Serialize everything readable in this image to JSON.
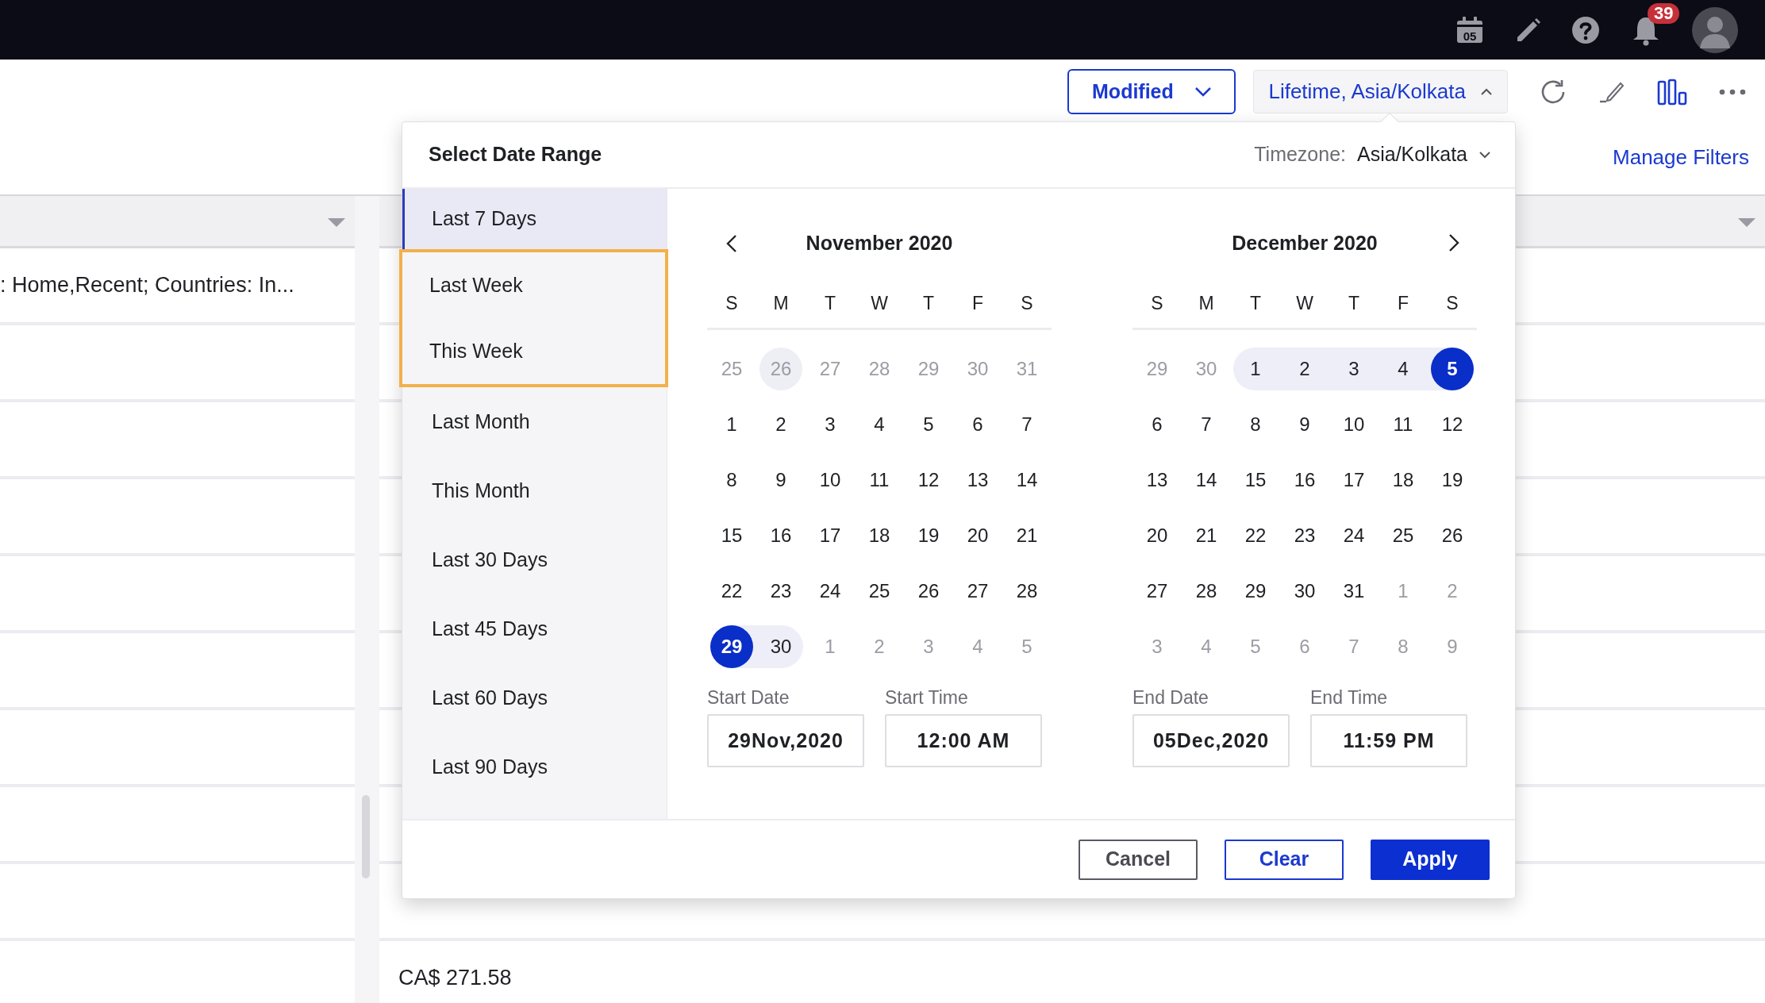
{
  "top_bar": {
    "calendar_day": "05",
    "notification_count": "39"
  },
  "toolbar": {
    "sort_button": "Modified",
    "date_button": "Lifetime, Asia/Kolkata",
    "date_expanded": true,
    "manage_filters": "Manage Filters"
  },
  "background_table": {
    "filter_cell": ": Home,Recent; Countries: In...",
    "amount_cell": "CA$ 271.58"
  },
  "date_picker": {
    "title": "Select Date Range",
    "timezone_label": "Timezone:",
    "timezone": "Asia/Kolkata",
    "presets": [
      {
        "label": "Last 7 Days",
        "selected": true,
        "highlighted": false
      },
      {
        "label": "Last Week",
        "selected": false,
        "highlighted": true
      },
      {
        "label": "This Week",
        "selected": false,
        "highlighted": true
      },
      {
        "label": "Last Month",
        "selected": false,
        "highlighted": false
      },
      {
        "label": "This Month",
        "selected": false,
        "highlighted": false
      },
      {
        "label": "Last 30 Days",
        "selected": false,
        "highlighted": false
      },
      {
        "label": "Last 45 Days",
        "selected": false,
        "highlighted": false
      },
      {
        "label": "Last 60 Days",
        "selected": false,
        "highlighted": false
      },
      {
        "label": "Last 90 Days",
        "selected": false,
        "highlighted": false
      }
    ],
    "months": [
      {
        "title": "November 2020",
        "prev_arrow": true,
        "next_arrow": false,
        "weekdays": [
          "S",
          "M",
          "T",
          "W",
          "T",
          "F",
          "S"
        ],
        "days": [
          {
            "day": "25",
            "kind": "outside"
          },
          {
            "day": "26",
            "kind": "today"
          },
          {
            "day": "27",
            "kind": "outside"
          },
          {
            "day": "28",
            "kind": "outside"
          },
          {
            "day": "29",
            "kind": "outside"
          },
          {
            "day": "30",
            "kind": "outside"
          },
          {
            "day": "31",
            "kind": "outside"
          },
          {
            "day": "1",
            "kind": "normal"
          },
          {
            "day": "2",
            "kind": "normal"
          },
          {
            "day": "3",
            "kind": "normal"
          },
          {
            "day": "4",
            "kind": "normal"
          },
          {
            "day": "5",
            "kind": "normal"
          },
          {
            "day": "6",
            "kind": "normal"
          },
          {
            "day": "7",
            "kind": "normal"
          },
          {
            "day": "8",
            "kind": "normal"
          },
          {
            "day": "9",
            "kind": "normal"
          },
          {
            "day": "10",
            "kind": "normal"
          },
          {
            "day": "11",
            "kind": "normal"
          },
          {
            "day": "12",
            "kind": "normal"
          },
          {
            "day": "13",
            "kind": "normal"
          },
          {
            "day": "14",
            "kind": "normal"
          },
          {
            "day": "15",
            "kind": "normal"
          },
          {
            "day": "16",
            "kind": "normal"
          },
          {
            "day": "17",
            "kind": "normal"
          },
          {
            "day": "18",
            "kind": "normal"
          },
          {
            "day": "19",
            "kind": "normal"
          },
          {
            "day": "20",
            "kind": "normal"
          },
          {
            "day": "21",
            "kind": "normal"
          },
          {
            "day": "22",
            "kind": "normal"
          },
          {
            "day": "23",
            "kind": "normal"
          },
          {
            "day": "24",
            "kind": "normal"
          },
          {
            "day": "25",
            "kind": "normal"
          },
          {
            "day": "26",
            "kind": "normal"
          },
          {
            "day": "27",
            "kind": "normal"
          },
          {
            "day": "28",
            "kind": "normal"
          },
          {
            "day": "29",
            "kind": "start"
          },
          {
            "day": "30",
            "kind": "range"
          },
          {
            "day": "1",
            "kind": "outside"
          },
          {
            "day": "2",
            "kind": "outside"
          },
          {
            "day": "3",
            "kind": "outside"
          },
          {
            "day": "4",
            "kind": "outside"
          },
          {
            "day": "5",
            "kind": "outside"
          }
        ]
      },
      {
        "title": "December 2020",
        "prev_arrow": false,
        "next_arrow": true,
        "weekdays": [
          "S",
          "M",
          "T",
          "W",
          "T",
          "F",
          "S"
        ],
        "days": [
          {
            "day": "29",
            "kind": "outside"
          },
          {
            "day": "30",
            "kind": "outside"
          },
          {
            "day": "1",
            "kind": "range"
          },
          {
            "day": "2",
            "kind": "range"
          },
          {
            "day": "3",
            "kind": "range"
          },
          {
            "day": "4",
            "kind": "range"
          },
          {
            "day": "5",
            "kind": "end"
          },
          {
            "day": "6",
            "kind": "normal"
          },
          {
            "day": "7",
            "kind": "normal"
          },
          {
            "day": "8",
            "kind": "normal"
          },
          {
            "day": "9",
            "kind": "normal"
          },
          {
            "day": "10",
            "kind": "normal"
          },
          {
            "day": "11",
            "kind": "normal"
          },
          {
            "day": "12",
            "kind": "normal"
          },
          {
            "day": "13",
            "kind": "normal"
          },
          {
            "day": "14",
            "kind": "normal"
          },
          {
            "day": "15",
            "kind": "normal"
          },
          {
            "day": "16",
            "kind": "normal"
          },
          {
            "day": "17",
            "kind": "normal"
          },
          {
            "day": "18",
            "kind": "normal"
          },
          {
            "day": "19",
            "kind": "normal"
          },
          {
            "day": "20",
            "kind": "normal"
          },
          {
            "day": "21",
            "kind": "normal"
          },
          {
            "day": "22",
            "kind": "normal"
          },
          {
            "day": "23",
            "kind": "normal"
          },
          {
            "day": "24",
            "kind": "normal"
          },
          {
            "day": "25",
            "kind": "normal"
          },
          {
            "day": "26",
            "kind": "normal"
          },
          {
            "day": "27",
            "kind": "normal"
          },
          {
            "day": "28",
            "kind": "normal"
          },
          {
            "day": "29",
            "kind": "normal"
          },
          {
            "day": "30",
            "kind": "normal"
          },
          {
            "day": "31",
            "kind": "normal"
          },
          {
            "day": "1",
            "kind": "outside"
          },
          {
            "day": "2",
            "kind": "outside"
          },
          {
            "day": "3",
            "kind": "outside"
          },
          {
            "day": "4",
            "kind": "outside"
          },
          {
            "day": "5",
            "kind": "outside"
          },
          {
            "day": "6",
            "kind": "outside"
          },
          {
            "day": "7",
            "kind": "outside"
          },
          {
            "day": "8",
            "kind": "outside"
          },
          {
            "day": "9",
            "kind": "outside"
          }
        ]
      }
    ],
    "fields": [
      {
        "label": "Start Date",
        "value": "29Nov,2020"
      },
      {
        "label": "Start Time",
        "value": "12:00 AM"
      },
      {
        "label": "End Date",
        "value": "05Dec,2020"
      },
      {
        "label": "End Time",
        "value": "11:59 PM"
      }
    ],
    "buttons": [
      {
        "label": "Cancel",
        "kind": "secondary"
      },
      {
        "label": "Clear",
        "kind": "outline"
      },
      {
        "label": "Apply",
        "kind": "primary"
      }
    ]
  }
}
